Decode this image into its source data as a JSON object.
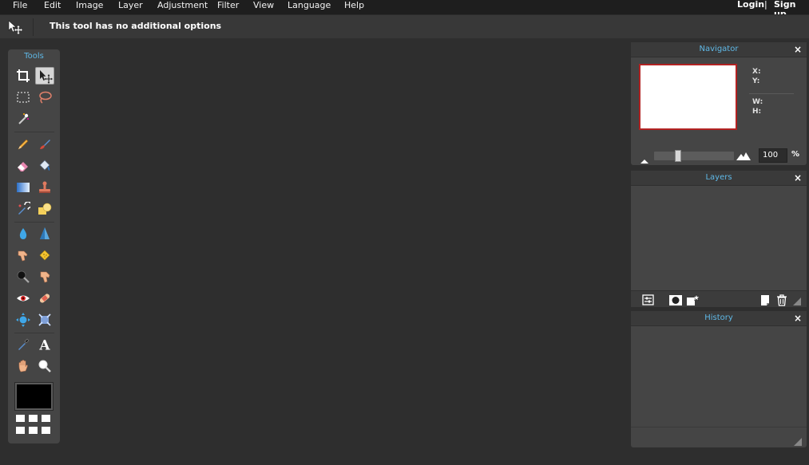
{
  "menu": {
    "items": [
      "File",
      "Edit",
      "Image",
      "Layer",
      "Adjustment",
      "Filter",
      "View",
      "Language",
      "Help"
    ],
    "login": "Login",
    "separator": "|",
    "signup": "Sign up"
  },
  "options_bar": {
    "message": "This tool has no additional options",
    "active_tool_icon": "move-icon"
  },
  "tools_panel": {
    "title": "Tools",
    "active_tool": "move",
    "foreground_color": "#000000",
    "tools": [
      "crop-icon",
      "move-icon",
      "rect-select-icon",
      "lasso-icon",
      "magic-wand-icon",
      "pencil-icon",
      "brush-icon",
      "eraser-icon",
      "paint-bucket-icon",
      "gradient-icon",
      "clone-stamp-icon",
      "color-replace-icon",
      "drawing-shape-icon",
      "blur-icon",
      "sharpen-icon",
      "smudge-icon",
      "sponge-icon",
      "dodge-icon",
      "burn-icon",
      "red-eye-icon",
      "spot-heal-icon",
      "bloat-icon",
      "pinch-icon",
      "color-picker-icon",
      "type-icon",
      "hand-icon",
      "zoom-icon"
    ]
  },
  "navigator": {
    "title": "Navigator",
    "close": "×",
    "x_label": "X:",
    "y_label": "Y:",
    "w_label": "W:",
    "h_label": "H:",
    "zoom_value": "100",
    "zoom_unit": "%",
    "zoom_fraction": 0.28
  },
  "layers": {
    "title": "Layers",
    "close": "×"
  },
  "history": {
    "title": "History",
    "close": "×"
  },
  "colors": {
    "accent": "#5fb8e6",
    "preview_border": "#b22222",
    "background": "#2e2e2e",
    "panel": "#454545"
  }
}
